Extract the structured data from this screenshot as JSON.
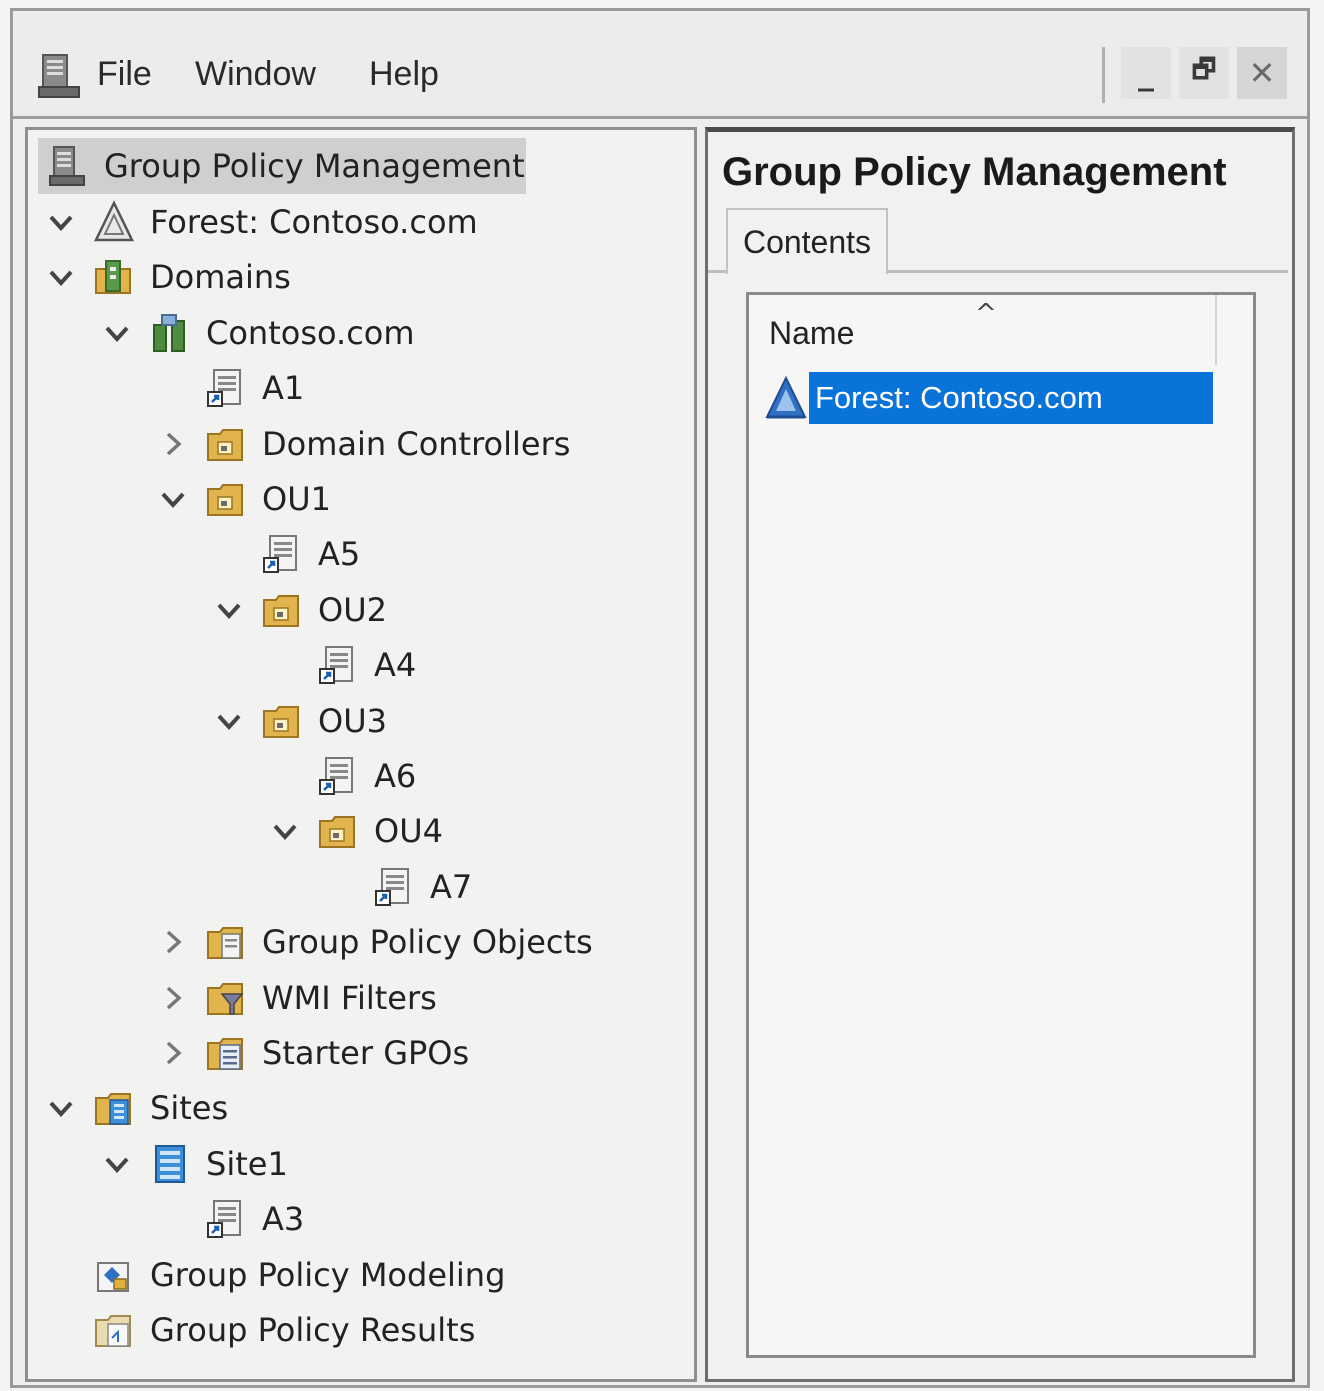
{
  "menubar": {
    "items": [
      {
        "label": "File"
      },
      {
        "label": "Window"
      },
      {
        "label": "Help"
      }
    ],
    "controls": {
      "minimize": "_",
      "restore": "🗗",
      "close": "✕"
    }
  },
  "tree": {
    "root": "Group Policy Management",
    "nodes": [
      {
        "label": "Forest: Contoso.com",
        "icon": "forest-icon",
        "expand": "expanded"
      },
      {
        "label": "Domains",
        "icon": "domains-icon",
        "expand": "expanded"
      },
      {
        "label": "Contoso.com",
        "icon": "domain-icon",
        "expand": "expanded"
      },
      {
        "label": "A1",
        "icon": "gpo-link-icon",
        "expand": "none"
      },
      {
        "label": "Domain Controllers",
        "icon": "ou-folder-icon",
        "expand": "collapsed"
      },
      {
        "label": "OU1",
        "icon": "ou-folder-icon",
        "expand": "expanded"
      },
      {
        "label": "A5",
        "icon": "gpo-link-icon",
        "expand": "none"
      },
      {
        "label": "OU2",
        "icon": "ou-folder-icon",
        "expand": "expanded"
      },
      {
        "label": "A4",
        "icon": "gpo-link-icon",
        "expand": "none"
      },
      {
        "label": "OU3",
        "icon": "ou-folder-icon",
        "expand": "expanded"
      },
      {
        "label": "A6",
        "icon": "gpo-link-icon",
        "expand": "none"
      },
      {
        "label": "OU4",
        "icon": "ou-folder-icon",
        "expand": "expanded"
      },
      {
        "label": "A7",
        "icon": "gpo-link-icon",
        "expand": "none"
      },
      {
        "label": "Group Policy Objects",
        "icon": "gpo-container-icon",
        "expand": "collapsed"
      },
      {
        "label": "WMI Filters",
        "icon": "wmi-filter-icon",
        "expand": "collapsed"
      },
      {
        "label": "Starter GPOs",
        "icon": "starter-gpo-icon",
        "expand": "collapsed"
      },
      {
        "label": "Sites",
        "icon": "sites-icon",
        "expand": "expanded"
      },
      {
        "label": "Site1",
        "icon": "site-icon",
        "expand": "expanded"
      },
      {
        "label": "A3",
        "icon": "gpo-link-icon",
        "expand": "none"
      },
      {
        "label": "Group Policy Modeling",
        "icon": "modeling-icon",
        "expand": "none"
      },
      {
        "label": "Group Policy Results",
        "icon": "results-icon",
        "expand": "none"
      }
    ]
  },
  "content": {
    "title": "Group Policy Management",
    "tab": "Contents",
    "column": "Name",
    "selected_item": "Forest: Contoso.com"
  },
  "colors": {
    "selection": "#0a73d9",
    "folder": "#e2b44e"
  }
}
